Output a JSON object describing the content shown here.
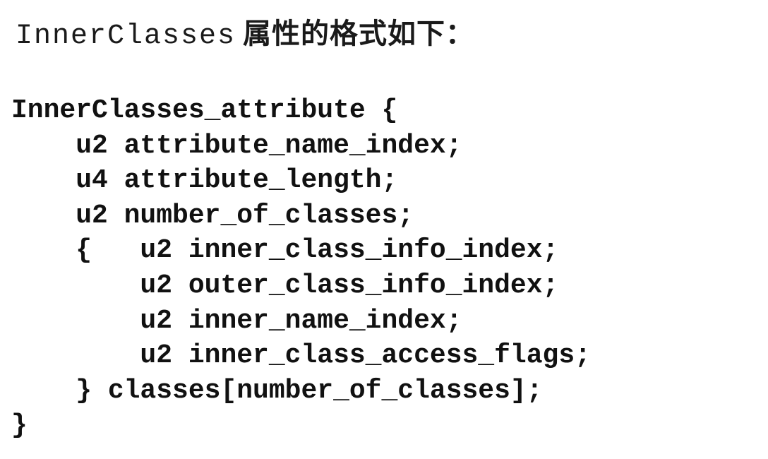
{
  "heading": {
    "code_term": "InnerClasses",
    "text": "属性的格式如下："
  },
  "code": {
    "lines": [
      "InnerClasses_attribute {",
      "    u2 attribute_name_index;",
      "    u4 attribute_length;",
      "    u2 number_of_classes;",
      "    {   u2 inner_class_info_index;",
      "        u2 outer_class_info_index;",
      "        u2 inner_name_index;",
      "        u2 inner_class_access_flags;",
      "    } classes[number_of_classes];",
      "}"
    ]
  }
}
